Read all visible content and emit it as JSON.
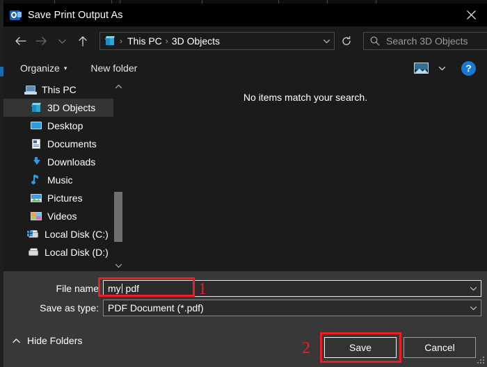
{
  "window": {
    "title": "Save Print Output As",
    "app_icon": "outlook-icon",
    "close_icon": "close-icon"
  },
  "nav": {
    "back_icon": "arrow-left-icon",
    "forward_icon": "arrow-right-icon",
    "recent_icon": "chevron-down-icon",
    "up_icon": "arrow-up-icon",
    "refresh_icon": "refresh-icon",
    "address_icon": "3d-objects-cube-icon",
    "breadcrumb": [
      "This PC",
      "3D Objects"
    ],
    "breadcrumb_separator": "›",
    "address_chevron": "chevron-down-icon"
  },
  "search": {
    "icon": "search-icon",
    "placeholder": "Search 3D Objects",
    "value": ""
  },
  "toolbar": {
    "organize_label": "Organize",
    "organize_caret": "▾",
    "new_folder_label": "New folder",
    "view_icon": "view-mode-icon",
    "view_chevron": "chevron-down-icon",
    "help_label": "?",
    "help_icon": "help-icon"
  },
  "sidebar": {
    "items": [
      {
        "label": "This PC",
        "icon": "this-pc-icon",
        "selected": false
      },
      {
        "label": "3D Objects",
        "icon": "3d-objects-cube-icon",
        "selected": true
      },
      {
        "label": "Desktop",
        "icon": "desktop-icon",
        "selected": false
      },
      {
        "label": "Documents",
        "icon": "documents-icon",
        "selected": false
      },
      {
        "label": "Downloads",
        "icon": "downloads-icon",
        "selected": false
      },
      {
        "label": "Music",
        "icon": "music-icon",
        "selected": false
      },
      {
        "label": "Pictures",
        "icon": "pictures-icon",
        "selected": false
      },
      {
        "label": "Videos",
        "icon": "videos-icon",
        "selected": false
      },
      {
        "label": "Local Disk (C:)",
        "icon": "local-disk-c-icon",
        "selected": false
      },
      {
        "label": "Local Disk (D:)",
        "icon": "local-disk-d-icon",
        "selected": false
      }
    ],
    "scroll_up_icon": "chevron-up-icon",
    "scroll_down_icon": "chevron-down-icon"
  },
  "content": {
    "empty_message": "No items match your search."
  },
  "form": {
    "file_name_label": "File name",
    "file_name_value_before_caret": "my",
    "file_name_value_after_caret": " pdf",
    "file_name_value": "my pdf",
    "save_as_type_label": "Save as type:",
    "save_as_type_value": "PDF Document (*.pdf)",
    "combo_chevron": "chevron-down-icon"
  },
  "footer": {
    "hide_folders_label": "Hide Folders",
    "hide_folders_icon": "chevron-up-icon",
    "save_label": "Save",
    "cancel_label": "Cancel",
    "resize_grip": "resize-grip-icon"
  },
  "annotations": {
    "marker_one": "1",
    "marker_two": "2",
    "color": "#ee1c25"
  },
  "colors": {
    "window_bg": "#1b1b1b",
    "titlebar_bg": "#000000",
    "panel_bg": "#383838",
    "selected_item": "#333333",
    "accent_blue": "#1878d4",
    "annotation_red": "#ee1c25"
  }
}
